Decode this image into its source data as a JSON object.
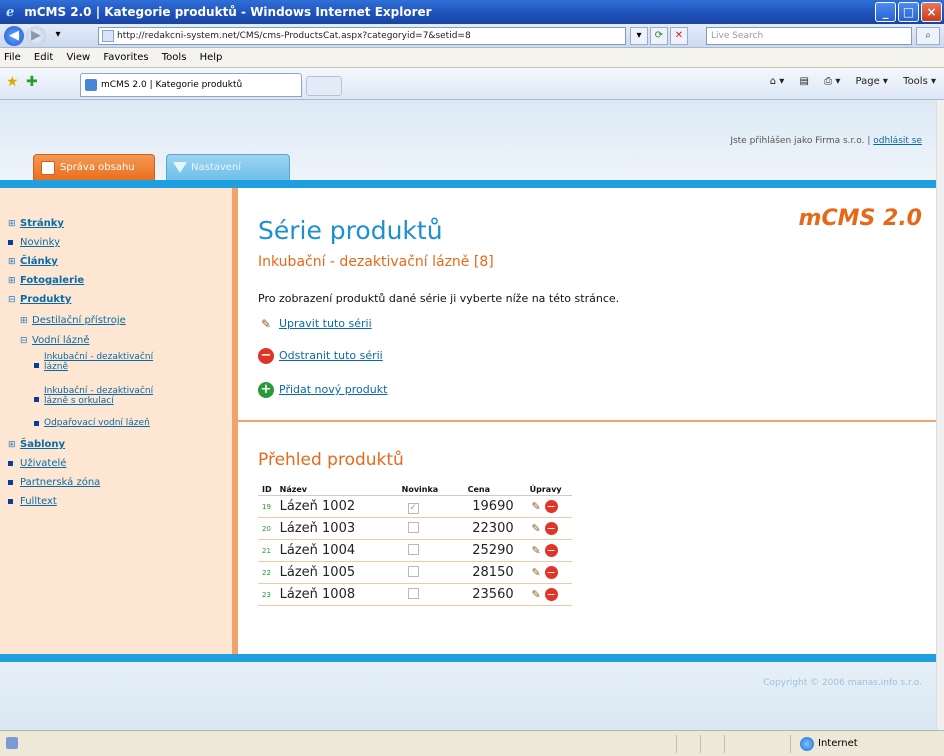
{
  "browser": {
    "title": "mCMS 2.0 | Kategorie produktů - Windows Internet Explorer",
    "url": "http://redakcni-system.net/CMS/cms-ProductsCat.aspx?categoryid=7&setid=8",
    "search_placeholder": "Live Search",
    "menu": [
      "File",
      "Edit",
      "View",
      "Favorites",
      "Tools",
      "Help"
    ],
    "tab_label": "mCMS 2.0 | Kategorie produktů",
    "commands": [
      "Page ▾",
      "Tools ▾"
    ],
    "status_zone": "Internet"
  },
  "header": {
    "tab_main": "Správa obsahu",
    "tab_other": "Nastavení",
    "login_prefix": "Jste přihlášen jako Firma s.r.o. |",
    "logout": "odhlásit se"
  },
  "sidebar": {
    "items": [
      {
        "label": "Stránky",
        "bold": true,
        "marker": "⊞"
      },
      {
        "label": "Novinky",
        "bold": false,
        "marker": "■"
      },
      {
        "label": "Články",
        "bold": true,
        "marker": "⊞"
      },
      {
        "label": "Fotogalerie",
        "bold": true,
        "marker": "⊞"
      },
      {
        "label": "Produkty",
        "bold": true,
        "marker": "⊟"
      },
      {
        "label": "Destilační přístroje",
        "bold": false,
        "marker": "⊞"
      },
      {
        "label": "Vodní lázně",
        "bold": false,
        "marker": "⊟"
      },
      {
        "label": "Inkubační - dezaktivační lázně",
        "bold": false,
        "marker": "■"
      },
      {
        "label": "Inkubační - dezaktivační lázně s orkulací",
        "bold": false,
        "marker": "■"
      },
      {
        "label": "Odpařovací vodní lázeň",
        "bold": false,
        "marker": "■"
      },
      {
        "label": "Šablony",
        "bold": true,
        "marker": "⊞"
      },
      {
        "label": "Uživatelé",
        "bold": false,
        "marker": "■"
      },
      {
        "label": "Partnerská zóna",
        "bold": false,
        "marker": "■"
      },
      {
        "label": "Fulltext",
        "bold": false,
        "marker": "■"
      }
    ],
    "sub_lines": {
      "item7_line1": "Inkubační - dezaktivační",
      "item7_line2": "lázně",
      "item8_line1": "Inkubační - dezaktivační",
      "item8_line2": "lázně s orkulací"
    }
  },
  "main": {
    "title": "Série produktů",
    "logo": "mCMS 2.0",
    "subtitle": "Inkubační - dezaktivační lázně [8]",
    "intro": "Pro zobrazení produktů dané série ji vyberte níže na této stránce.",
    "actions": {
      "edit": "Upravit tuto sérii",
      "delete": "Odstranit tuto sérii",
      "add": "Přidat nový produkt"
    },
    "overview_title": "Přehled produktů",
    "table": {
      "headers": [
        "ID",
        "Název",
        "Novinka",
        "Cena",
        "Úpravy"
      ],
      "rows": [
        {
          "id": "19",
          "name": "Lázeň 1002",
          "novinka": true,
          "price": "19690"
        },
        {
          "id": "20",
          "name": "Lázeň 1003",
          "novinka": false,
          "price": "22300"
        },
        {
          "id": "21",
          "name": "Lázeň 1004",
          "novinka": false,
          "price": "25290"
        },
        {
          "id": "22",
          "name": "Lázeň 1005",
          "novinka": false,
          "price": "28150"
        },
        {
          "id": "23",
          "name": "Lázeň 1008",
          "novinka": false,
          "price": "23560"
        }
      ]
    }
  },
  "footer": {
    "copyright": "Copyright © 2006 manas.info s.r.o."
  },
  "colors": {
    "accent_blue": "#1e9fe0",
    "accent_orange": "#e8681a",
    "sidebar_bg": "#fde7d3"
  }
}
